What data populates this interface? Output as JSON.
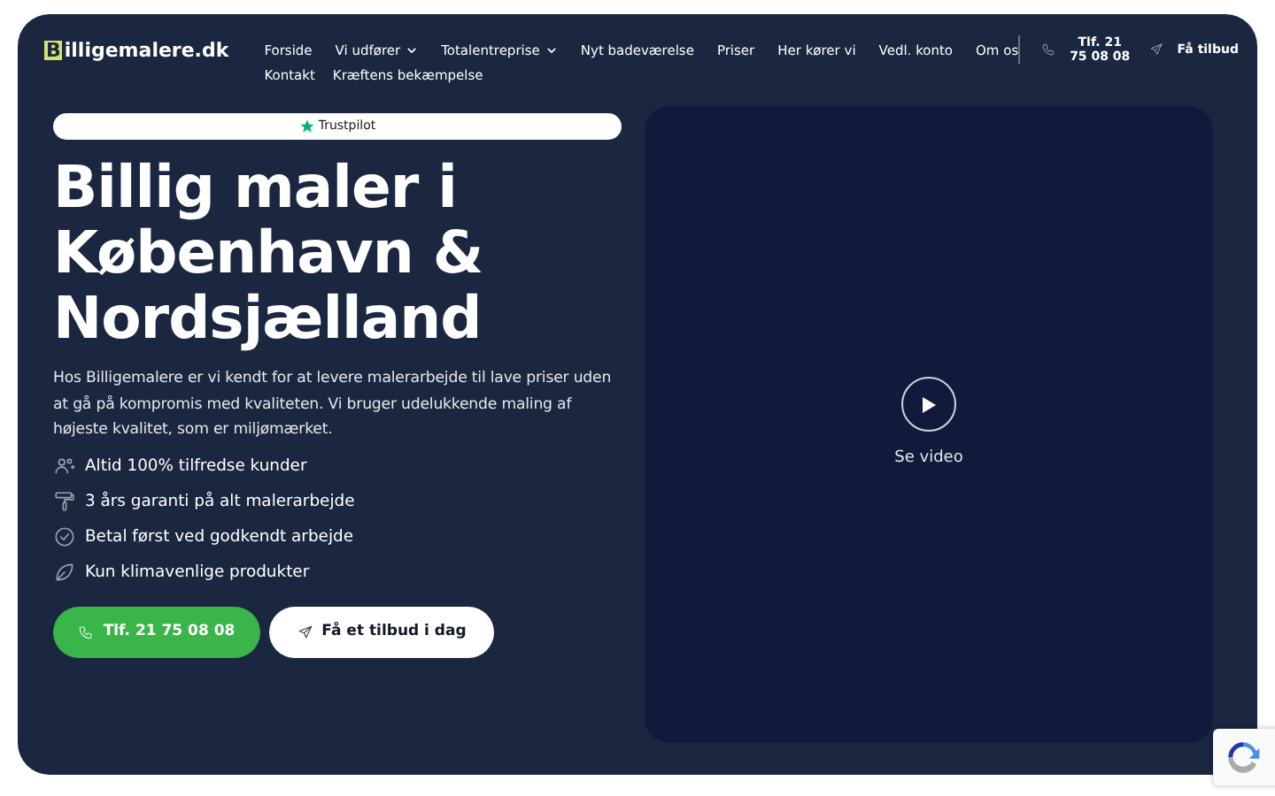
{
  "logo": {
    "initial": "B",
    "rest": "illigemalere.dk"
  },
  "nav": [
    {
      "label": "Forside",
      "dropdown": false
    },
    {
      "label": "Vi udfører",
      "dropdown": true
    },
    {
      "label": "Totalentreprise",
      "dropdown": true
    },
    {
      "label": "Nyt badeværelse",
      "dropdown": false
    },
    {
      "label": "Priser",
      "dropdown": false
    },
    {
      "label": "Her kører vi",
      "dropdown": false
    },
    {
      "label": "Vedl. konto",
      "dropdown": false
    },
    {
      "label": "Om os",
      "dropdown": false
    },
    {
      "label": "Kontakt",
      "dropdown": false
    },
    {
      "label": "Kræftens bekæmpelse",
      "dropdown": false
    }
  ],
  "header_actions": [
    {
      "kind": "phone",
      "label": "Tlf. 21 75 08 08"
    },
    {
      "kind": "send",
      "label": "Få tilbud"
    }
  ],
  "trustpilot": "Trustpilot",
  "headline": "Billig maler i København & Nordsjælland",
  "intro": "Hos Billigemalere er vi kendt for at levere malerarbejde til lave priser uden at gå på kompromis med kvaliteten. Vi bruger udelukkende maling af højeste kvalitet, som er miljømærket.",
  "features": [
    {
      "kind": "people",
      "text": "Altid 100% tilfredse kunder"
    },
    {
      "kind": "roller",
      "text": "3 års garanti på alt malerarbejde"
    },
    {
      "kind": "check",
      "text": "Betal først ved godkendt arbejde"
    },
    {
      "kind": "leaf",
      "text": "Kun klimavenlige produkter"
    }
  ],
  "buttons": [
    {
      "kind": "phone",
      "label": "Tlf. 21 75 08 08"
    },
    {
      "kind": "send",
      "label": "Få et tilbud i dag"
    }
  ],
  "video": {
    "label": "Se video"
  }
}
